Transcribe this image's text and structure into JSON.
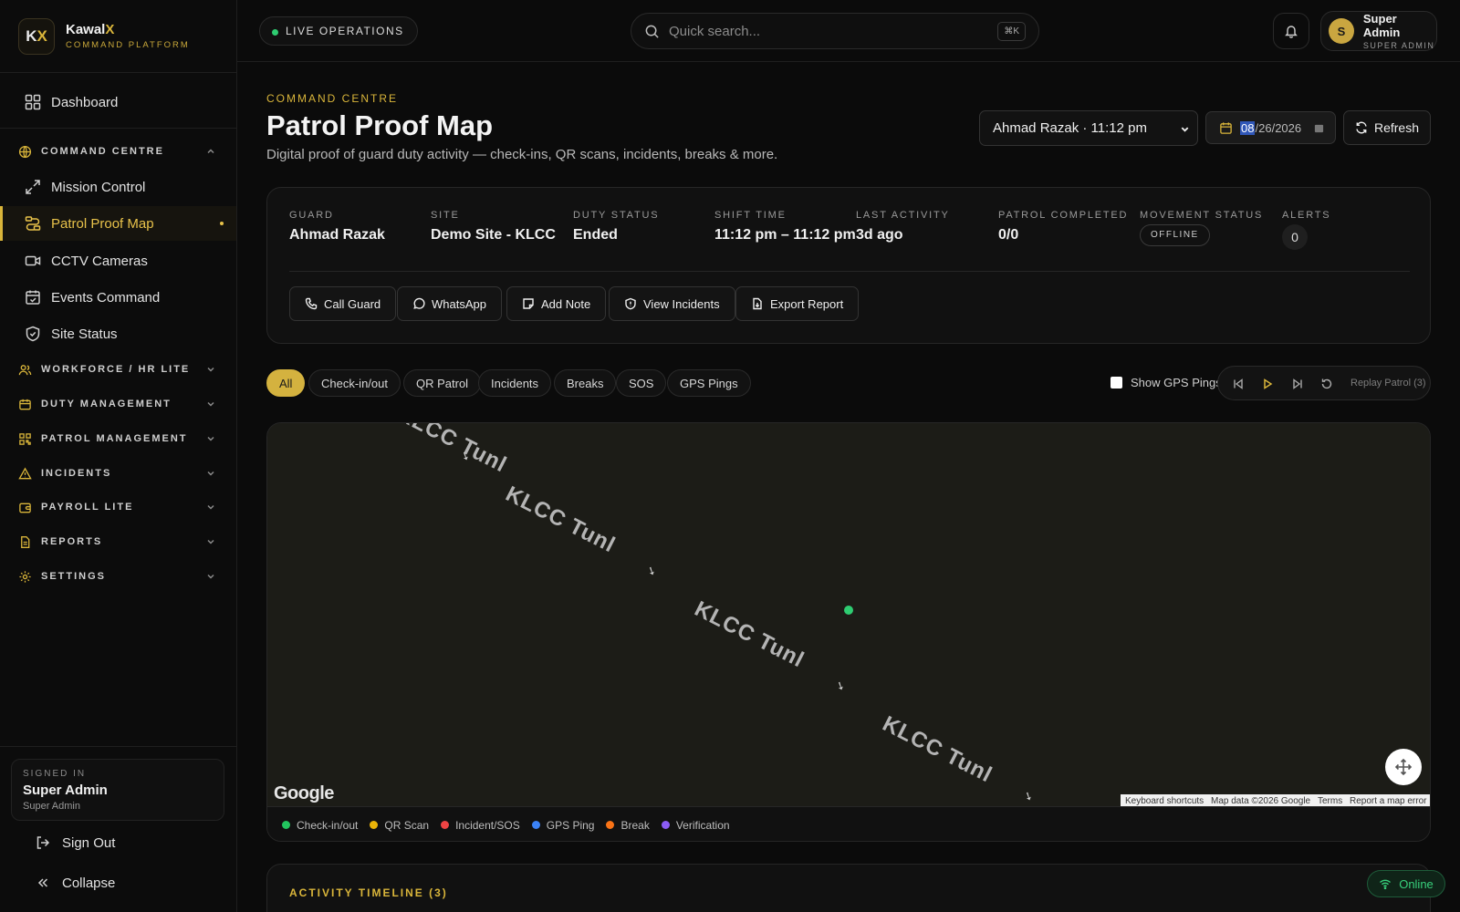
{
  "brand": {
    "logo": "KX",
    "name": "Kawal",
    "name_x": "X",
    "subtitle": "COMMAND PLATFORM"
  },
  "sidebar": {
    "dashboard": "Dashboard",
    "command_centre_group": "COMMAND CENTRE",
    "items": [
      {
        "label": "Mission Control",
        "icon": "expand-arrows-icon"
      },
      {
        "label": "Patrol Proof Map",
        "icon": "route-icon",
        "active": true
      },
      {
        "label": "CCTV Cameras",
        "icon": "video-icon"
      },
      {
        "label": "Events Command",
        "icon": "calendar-check-icon"
      },
      {
        "label": "Site Status",
        "icon": "shield-check-icon"
      }
    ],
    "groups": [
      {
        "label": "WORKFORCE / HR LITE",
        "icon": "users-icon"
      },
      {
        "label": "DUTY MANAGEMENT",
        "icon": "clipboard-icon"
      },
      {
        "label": "PATROL MANAGEMENT",
        "icon": "qr-icon"
      },
      {
        "label": "INCIDENTS",
        "icon": "warning-icon"
      },
      {
        "label": "PAYROLL LITE",
        "icon": "wallet-icon"
      },
      {
        "label": "REPORTS",
        "icon": "file-icon"
      },
      {
        "label": "SETTINGS",
        "icon": "gear-icon"
      }
    ],
    "signed_in": {
      "label": "SIGNED IN",
      "name": "Super Admin",
      "role": "Super Admin"
    },
    "sign_out": "Sign Out",
    "collapse": "Collapse"
  },
  "topbar": {
    "live_label": "LIVE OPERATIONS",
    "search_placeholder": "Quick search...",
    "search_shortcut": "⌘K",
    "user": {
      "initial": "S",
      "name": "Super Admin",
      "role": "SUPER ADMIN"
    }
  },
  "header": {
    "eyebrow": "COMMAND CENTRE",
    "title": "Patrol Proof Map",
    "subtitle": "Digital proof of guard duty activity — check-ins, QR scans, incidents, breaks & more.",
    "guard_select": "Ahmad Razak · 11:12 pm",
    "date": {
      "month": "08",
      "day": "26",
      "year": "2026"
    },
    "refresh": "Refresh"
  },
  "guard_card": {
    "fields": [
      {
        "label": "GUARD",
        "value": "Ahmad Razak"
      },
      {
        "label": "SITE",
        "value": "Demo Site - KLCC"
      },
      {
        "label": "DUTY STATUS",
        "value": "Ended"
      },
      {
        "label": "SHIFT TIME",
        "value": "11:12 pm – 11:12 pm"
      },
      {
        "label": "LAST ACTIVITY",
        "value": "3d ago"
      },
      {
        "label": "PATROL COMPLETED",
        "value": "0/0"
      }
    ],
    "movement_label": "MOVEMENT STATUS",
    "movement_value": "OFFLINE",
    "alerts_label": "ALERTS",
    "alerts_value": "0",
    "actions": {
      "call": "Call Guard",
      "whatsapp": "WhatsApp",
      "note": "Add Note",
      "incidents": "View Incidents",
      "export": "Export Report"
    }
  },
  "filters": {
    "chips": [
      "All",
      "Check-in/out",
      "QR Patrol",
      "Incidents",
      "Breaks",
      "SOS",
      "GPS Pings"
    ],
    "active": "All",
    "gps_toggle": "Show GPS Pings",
    "replay_label": "Replay Patrol (3)"
  },
  "map": {
    "road_label": "KLCC Tunl",
    "google": "Google",
    "attribution": [
      "Keyboard shortcuts",
      "Map data ©2026 Google",
      "Terms",
      "Report a map error"
    ],
    "legend": [
      {
        "label": "Check-in/out",
        "color": "#22c55e"
      },
      {
        "label": "QR Scan",
        "color": "#eab308"
      },
      {
        "label": "Incident/SOS",
        "color": "#ef4444"
      },
      {
        "label": "GPS Ping",
        "color": "#3b82f6"
      },
      {
        "label": "Break",
        "color": "#f97316"
      },
      {
        "label": "Verification",
        "color": "#8b5cf6"
      }
    ]
  },
  "timeline": {
    "title": "ACTIVITY TIMELINE (3)"
  },
  "status": {
    "online": "Online"
  },
  "colors": {
    "accent": "#d9b53a",
    "background": "#0b0b0b",
    "online": "#38d07c"
  }
}
